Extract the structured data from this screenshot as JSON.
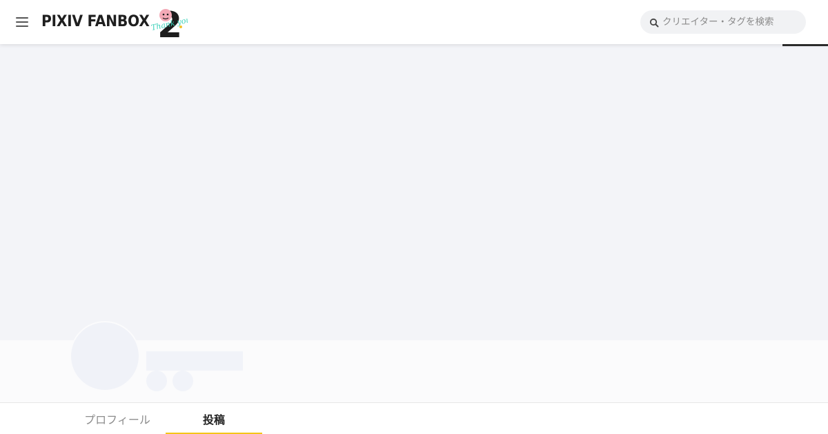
{
  "header": {
    "logo_text": "PIXIV FANBOX",
    "anniversary_badge": {
      "number": "2",
      "script_text": "Thank you",
      "icon": "mascot-face-icon",
      "colors": {
        "number": "#1d1d1d",
        "script": "#37d0b8",
        "accent": "#f2c12e",
        "face": "#f3a9b6"
      }
    },
    "search": {
      "placeholder": "クリエイター・タグを検索",
      "value": ""
    },
    "menu_icon": "hamburger-menu-icon"
  },
  "loading": {
    "progress_color": "#2b2b2b"
  },
  "profile": {
    "tabs": [
      {
        "label": "プロフィール",
        "active": false
      },
      {
        "label": "投稿",
        "active": true
      }
    ],
    "active_tab_indicator_color": "#f5c518"
  },
  "colors": {
    "cover_placeholder": "#f3f4f8",
    "skeleton": "#f1f3f9",
    "profile_bg": "#fbfbfc"
  }
}
